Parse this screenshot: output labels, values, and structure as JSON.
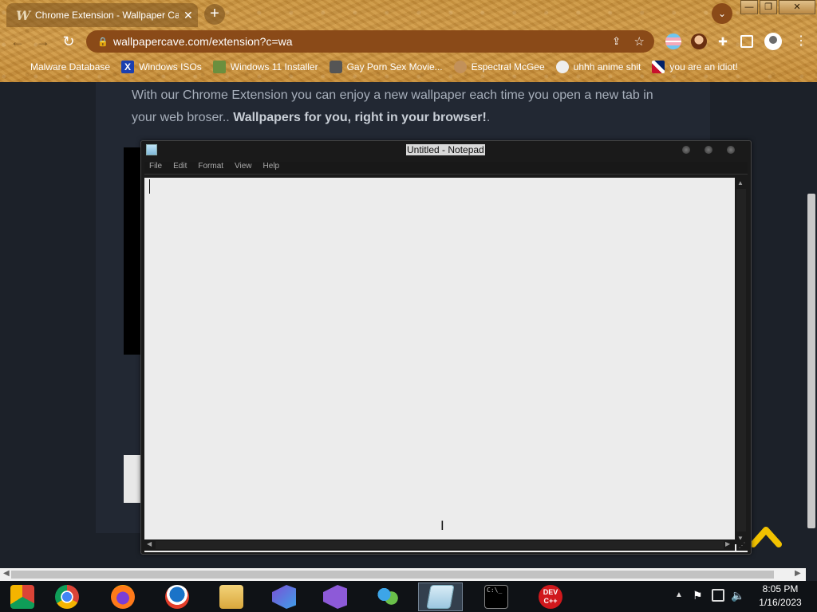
{
  "browser": {
    "tab": {
      "logo": "W",
      "title": "Chrome Extension - Wallpaper Cave",
      "close": "✕"
    },
    "new_tab": "+",
    "tab_search": "⌄",
    "window_controls": {
      "minimize": "—",
      "maximize": "❐",
      "close": "✕"
    },
    "nav": {
      "back": "←",
      "forward": "→",
      "reload": "↻"
    },
    "url": "wallpapercave.com/extension?c=wa",
    "bookmarks": [
      {
        "label": "Malware Database",
        "icon": "none"
      },
      {
        "label": "Windows ISOs",
        "icon": "x-icon"
      },
      {
        "label": "Windows 11 Installer",
        "icon": "windows-image-icon"
      },
      {
        "label": "Gay Porn Sex Movie...",
        "icon": "disk-icon"
      },
      {
        "label": "Espectral McGee",
        "icon": "face-icon"
      },
      {
        "label": "uhhh anime shit",
        "icon": "anime-icon"
      },
      {
        "label": "you are an idiot!",
        "icon": "uk-flag-icon"
      }
    ]
  },
  "page": {
    "text_plain": "With our Chrome Extension you can enjoy a new wallpaper each time you open a new tab in your web broser..",
    "text_bold": "Wallpapers for you, right in your browser!",
    "text_end": "."
  },
  "notepad": {
    "title": "Untitled - Notepad",
    "menu": [
      "File",
      "Edit",
      "Format",
      "View",
      "Help"
    ],
    "content": ""
  },
  "taskbar": {
    "apps": [
      "windows-chrome-icon",
      "chrome-icon",
      "firefox-icon",
      "edge-icon",
      "file-explorer-icon",
      "visual-studio-installer-icon",
      "visual-studio-icon",
      "people-icon",
      "notepad-icon",
      "cmd-icon",
      "dev-cpp-icon"
    ],
    "dev_label": "DEV C++",
    "time": "8:05 PM",
    "date": "1/16/2023"
  },
  "colors": {
    "accent_scroll_top": "#f2c200",
    "omnibox": "#8a4a18",
    "page_bg": "#1c2129"
  }
}
